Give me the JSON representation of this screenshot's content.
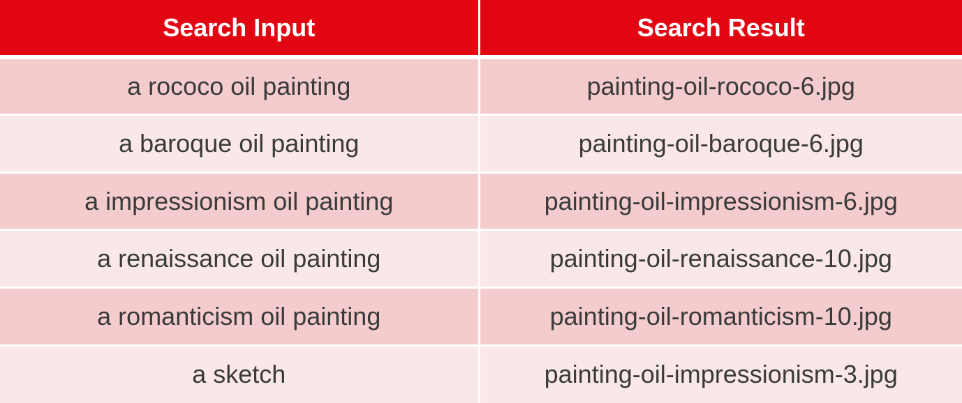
{
  "table": {
    "headers": [
      "Search Input",
      "Search Result"
    ],
    "rows": [
      [
        "a rococo oil painting",
        "painting-oil-rococo-6.jpg"
      ],
      [
        "a baroque oil painting",
        "painting-oil-baroque-6.jpg"
      ],
      [
        "a impressionism oil painting",
        "painting-oil-impressionism-6.jpg"
      ],
      [
        "a renaissance oil painting",
        "painting-oil-renaissance-10.jpg"
      ],
      [
        "a romanticism oil painting",
        "painting-oil-romanticism-10.jpg"
      ],
      [
        "a sketch",
        "painting-oil-impressionism-3.jpg"
      ]
    ]
  },
  "colors": {
    "header_bg": "#e20613",
    "header_text": "#ffffff",
    "row_odd_bg": "#f4cccd",
    "row_even_bg": "#fae8e8",
    "cell_text": "#3a3a3a"
  }
}
